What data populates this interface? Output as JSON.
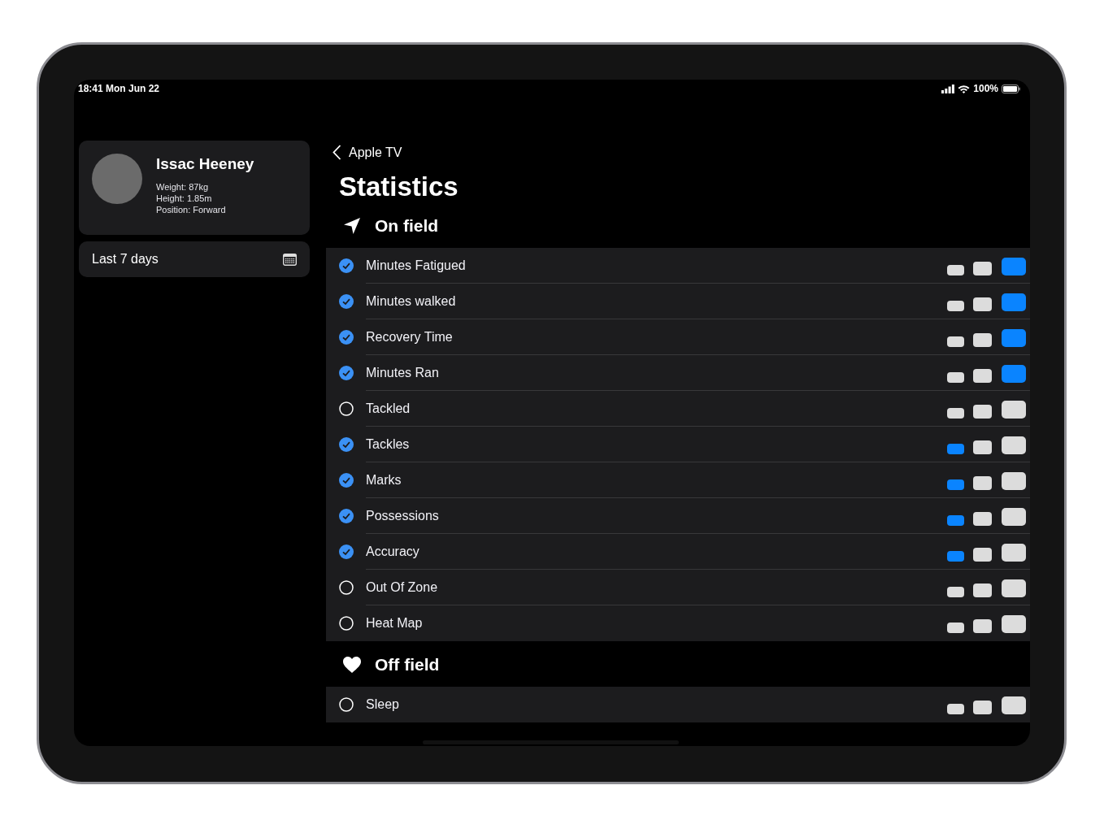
{
  "status_bar": {
    "time": "18:41 Mon Jun 22",
    "battery": "100%"
  },
  "profile": {
    "name": "Issac Heeney",
    "details": [
      "Weight: 87kg",
      "Height: 1.85m",
      "Position: Forward"
    ]
  },
  "date_range": {
    "label": "Last 7 days"
  },
  "nav": {
    "back": "Apple TV",
    "title": "Statistics"
  },
  "sections": [
    {
      "title": "On field",
      "items": [
        {
          "label": "Minutes Fatigued",
          "checked": true,
          "sizes": [
            {
              "selected": false
            },
            {
              "selected": false
            },
            {
              "selected": true
            }
          ]
        },
        {
          "label": "Minutes walked",
          "checked": true,
          "sizes": [
            {
              "selected": false
            },
            {
              "selected": false
            },
            {
              "selected": true
            }
          ]
        },
        {
          "label": "Recovery Time",
          "checked": true,
          "sizes": [
            {
              "selected": false
            },
            {
              "selected": false
            },
            {
              "selected": true
            }
          ]
        },
        {
          "label": "Minutes Ran",
          "checked": true,
          "sizes": [
            {
              "selected": false
            },
            {
              "selected": false
            },
            {
              "selected": true
            }
          ]
        },
        {
          "label": "Tackled",
          "checked": false,
          "sizes": [
            {
              "selected": false
            },
            {
              "selected": false
            },
            {
              "selected": false
            }
          ]
        },
        {
          "label": "Tackles",
          "checked": true,
          "sizes": [
            {
              "selected": true
            },
            {
              "selected": false
            },
            {
              "selected": false
            }
          ]
        },
        {
          "label": "Marks",
          "checked": true,
          "sizes": [
            {
              "selected": true
            },
            {
              "selected": false
            },
            {
              "selected": false
            }
          ]
        },
        {
          "label": "Possessions",
          "checked": true,
          "sizes": [
            {
              "selected": true
            },
            {
              "selected": false
            },
            {
              "selected": false
            }
          ]
        },
        {
          "label": "Accuracy",
          "checked": true,
          "sizes": [
            {
              "selected": true
            },
            {
              "selected": false
            },
            {
              "selected": false
            }
          ]
        },
        {
          "label": "Out Of Zone",
          "checked": false,
          "sizes": [
            {
              "selected": false
            },
            {
              "selected": false
            },
            {
              "selected": false
            }
          ]
        },
        {
          "label": "Heat Map",
          "checked": false,
          "sizes": [
            {
              "selected": false
            },
            {
              "selected": false
            },
            {
              "selected": false
            }
          ]
        }
      ]
    },
    {
      "title": "Off field",
      "items": [
        {
          "label": "Sleep",
          "checked": false,
          "sizes": [
            {
              "selected": false
            },
            {
              "selected": false
            },
            {
              "selected": false
            }
          ]
        }
      ]
    }
  ]
}
